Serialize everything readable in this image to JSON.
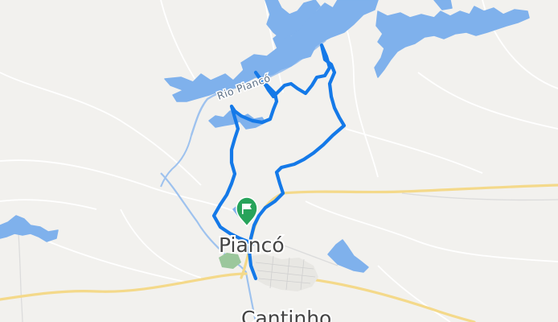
{
  "map": {
    "labels": {
      "town_main": "Piancó",
      "town_south": "Cantinho",
      "river": "Rio Piancó"
    },
    "colors": {
      "land": "#f2f1ee",
      "water": "#7fb1ec",
      "river_line": "#9ec2ee",
      "route": "#1479e8",
      "major_road": "#f4d98a",
      "minor_road": "#e3e3e3",
      "park": "#9bc79c",
      "marker": "#27a35a"
    },
    "icons": {
      "start_marker": "flag-marker-icon"
    }
  }
}
